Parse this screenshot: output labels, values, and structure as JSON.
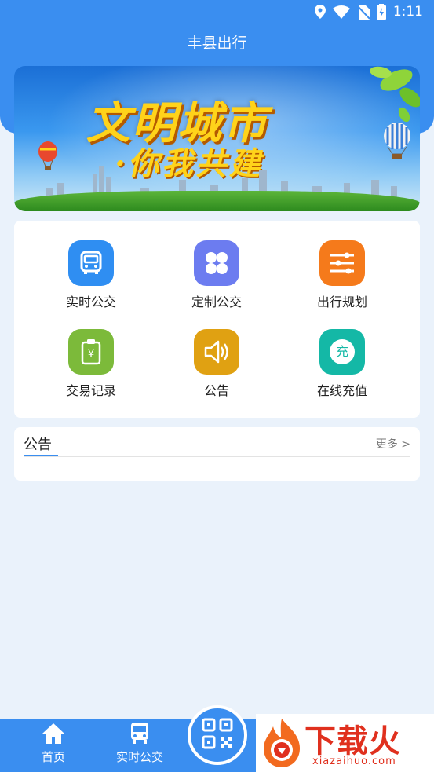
{
  "status_bar": {
    "time": "1:11"
  },
  "header": {
    "title": "丰县出行"
  },
  "banner": {
    "line1": "文明城市",
    "line2": "·你我共建"
  },
  "functions": [
    {
      "label": "实时公交",
      "icon": "bus-icon",
      "color": "#2f8ef2"
    },
    {
      "label": "定制公交",
      "icon": "grid-clover-icon",
      "color": "#6c7cf0"
    },
    {
      "label": "出行规划",
      "icon": "sliders-icon",
      "color": "#f57a1b"
    },
    {
      "label": "交易记录",
      "icon": "receipt-icon",
      "color": "#7cba3a"
    },
    {
      "label": "公告",
      "icon": "speaker-icon",
      "color": "#e0a112"
    },
    {
      "label": "在线充值",
      "icon": "recharge-icon",
      "color": "#14b8a6",
      "badge": "充"
    }
  ],
  "notice": {
    "title": "公告",
    "more": "更多 >"
  },
  "bottom_nav": {
    "items": [
      {
        "label": "首页",
        "icon": "home-icon"
      },
      {
        "label": "实时公交",
        "icon": "bus-icon"
      }
    ],
    "center_icon": "qr-code-icon"
  },
  "watermark": {
    "text": "下载火",
    "sub": "xiazaihuo.com"
  },
  "colors": {
    "primary": "#3a8ef0",
    "background": "#eaf2fb"
  }
}
